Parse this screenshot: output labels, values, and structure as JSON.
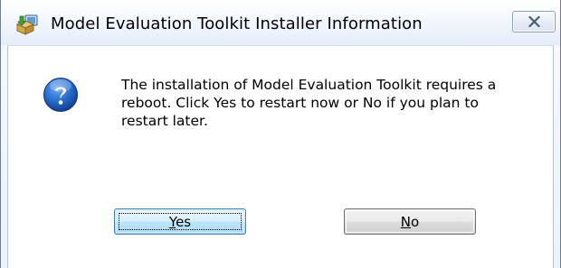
{
  "window": {
    "title": "Model Evaluation Toolkit Installer Information",
    "app_icon": "installer-icon",
    "close_icon": "close-x-icon"
  },
  "dialog": {
    "icon": "question-icon",
    "message": "The installation of Model Evaluation Toolkit requires a reboot.  Click Yes to restart now or No if you plan to restart later."
  },
  "buttons": {
    "yes": {
      "mnemonic": "Y",
      "rest": "es",
      "is_default": true
    },
    "no": {
      "mnemonic": "N",
      "rest": "o",
      "is_default": false
    }
  },
  "colors": {
    "titlebar_gradient_top": "#ffffff",
    "titlebar_gradient_bottom": "#e4edf8",
    "default_button_border": "#3c7fb1",
    "question_icon_blue": "#1e5fbf"
  }
}
